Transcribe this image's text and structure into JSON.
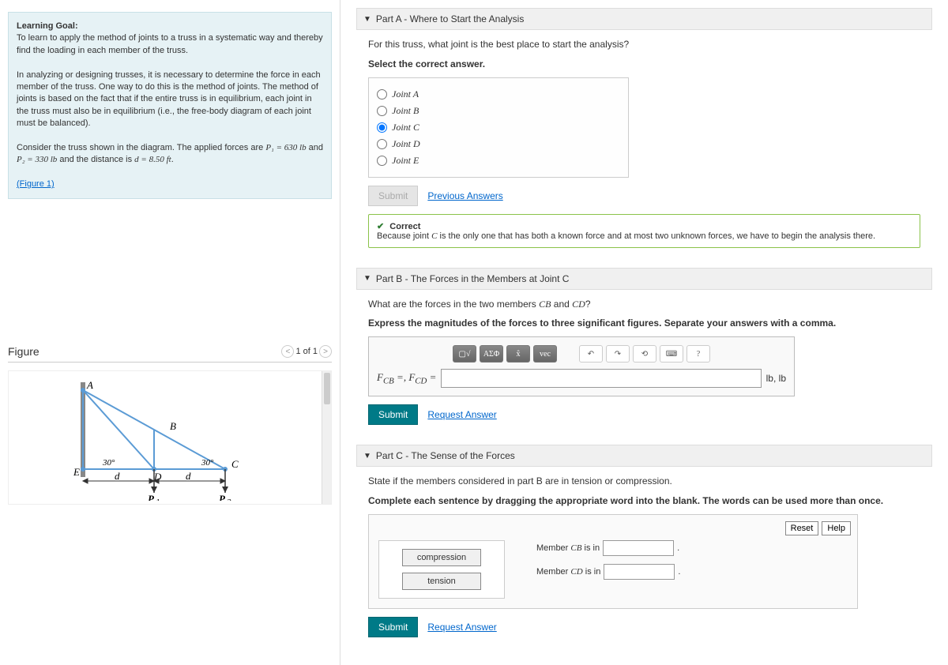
{
  "goal": {
    "heading": "Learning Goal:",
    "text1": "To learn to apply the method of joints to a truss in a systematic way and thereby find the loading in each member of the truss.",
    "text2": "In analyzing or designing trusses, it is necessary to determine the force in each member of the truss. One way to do this is the method of joints. The method of joints is based on the fact that if the entire truss is in equilibrium, each joint in the truss must also be in equilibrium (i.e., the free-body diagram of each joint must be balanced).",
    "text3a": "Consider the truss shown in the diagram. The applied forces are ",
    "text3b": " and the distance is ",
    "p1": "P₁ = 630 lb",
    "p2": "P₂ = 330 lb",
    "d": "d = 8.50 ft",
    "figlink": "(Figure 1)"
  },
  "figure": {
    "title": "Figure",
    "pager": "1 of 1"
  },
  "partA": {
    "title": "Part A - Where to Start the Analysis",
    "q": "For this truss, what joint is the best place to start the analysis?",
    "instr": "Select the correct answer.",
    "options": [
      "Joint A",
      "Joint B",
      "Joint C",
      "Joint D",
      "Joint E"
    ],
    "submit": "Submit",
    "prev": "Previous Answers",
    "fb_label": "Correct",
    "fb_text": "Because joint C is the only one that has both a known force and at most two unknown forces, we have to begin the analysis there."
  },
  "partB": {
    "title": "Part B - The Forces in the Members at Joint C",
    "q": "What are the forces in the two members CB and CD?",
    "instr": "Express the magnitudes of the forces to three significant figures. Separate your answers with a comma.",
    "label": "F_CB =, F_CD =",
    "units": "lb, lb",
    "submit": "Submit",
    "req": "Request Answer"
  },
  "partC": {
    "title": "Part C - The Sense of the Forces",
    "q": "State if the members considered in part B are in tension or compression.",
    "instr": "Complete each sentence by dragging the appropriate word into the blank. The words can be used more than once.",
    "reset": "Reset",
    "help": "Help",
    "chips": [
      "compression",
      "tension"
    ],
    "t1a": "Member CB is in ",
    "t2a": "Member CD is in ",
    "submit": "Submit",
    "req": "Request Answer"
  }
}
